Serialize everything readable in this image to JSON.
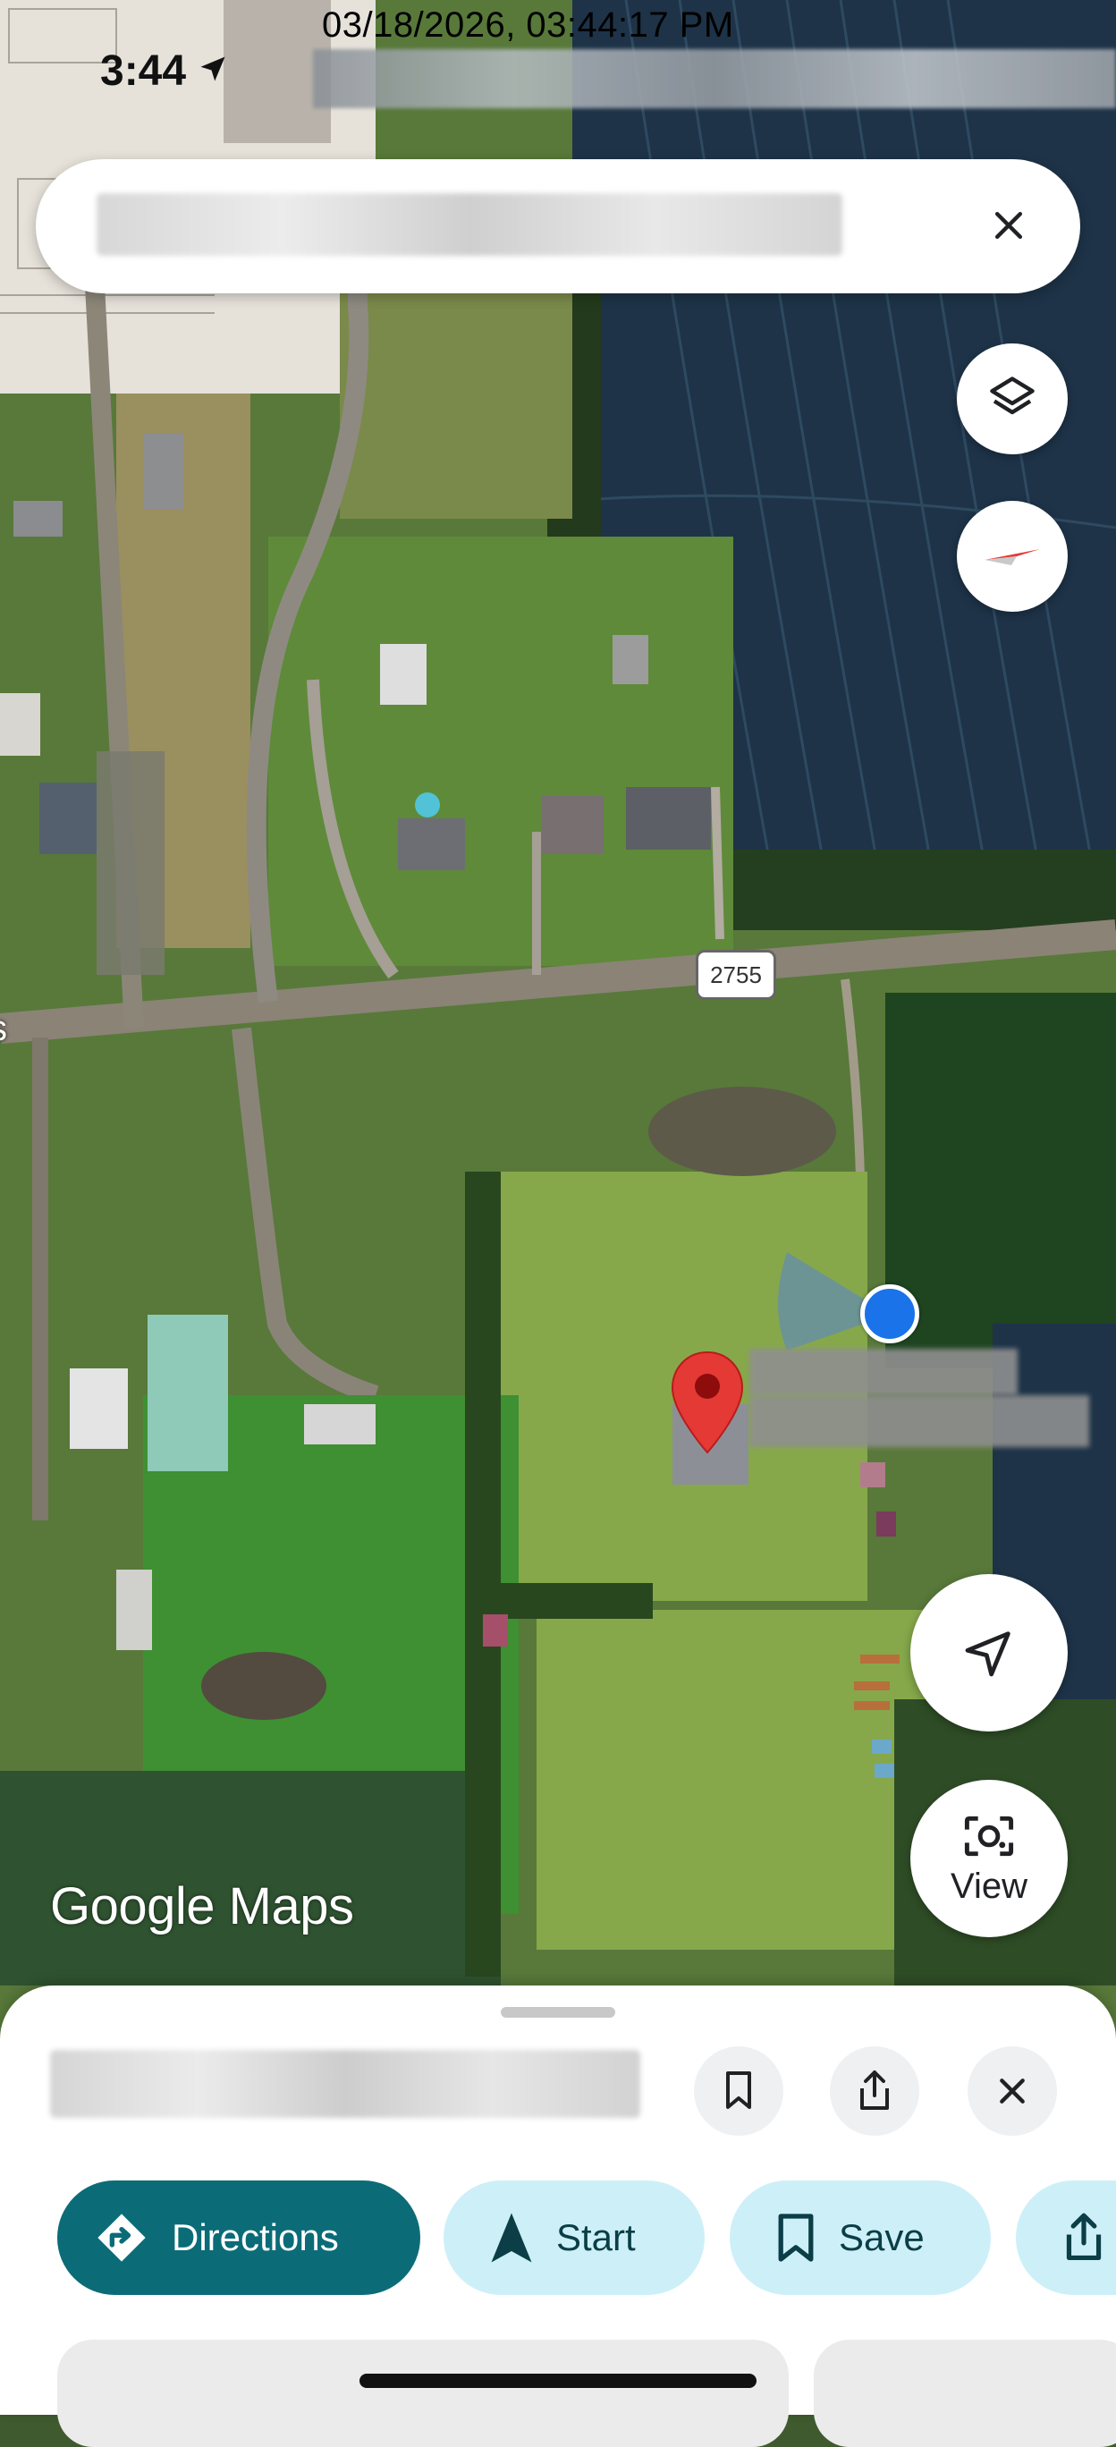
{
  "overlay": {
    "timestamp": "03/18/2026, 03:44:17 PM"
  },
  "status_bar": {
    "time": "3:44"
  },
  "search": {
    "query": ""
  },
  "map": {
    "road_shield": "2755",
    "logo": "Google Maps",
    "edge_label": "s"
  },
  "controls": {
    "view_label": "View"
  },
  "sheet": {
    "title": "",
    "actions": [
      {
        "label": "Directions",
        "icon": "directions-icon"
      },
      {
        "label": "Start",
        "icon": "navigation-arrow-icon"
      },
      {
        "label": "Save",
        "icon": "bookmark-icon"
      },
      {
        "label": "",
        "icon": "share-icon"
      }
    ]
  },
  "colors": {
    "primary_chip": "#0b6c78",
    "secondary_chip": "#cdf0f8",
    "pin": "#e53935",
    "location_dot": "#1a73e8"
  }
}
